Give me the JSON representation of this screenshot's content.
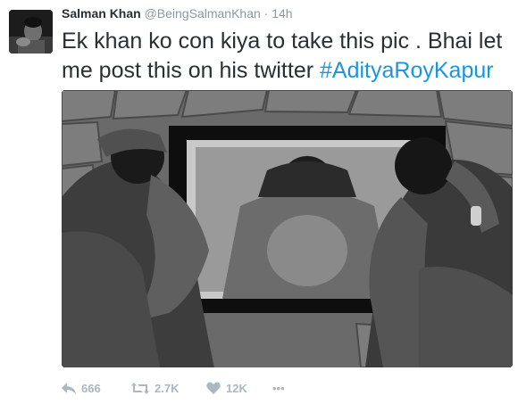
{
  "tweet": {
    "author_name": "Salman Khan",
    "handle": "@BeingSalmanKhan",
    "separator": "·",
    "time": "14h",
    "text_main": "Ek khan ko con kiya to take this pic . Bhai let me post this on his twitter ",
    "hashtag": "#AdityaRoyKapur"
  },
  "actions": {
    "reply_count": "666",
    "retweet_count": "2.7K",
    "like_count": "12K",
    "more_label": "•••"
  },
  "icons": {
    "reply": "reply-icon",
    "retweet": "retweet-icon",
    "like": "heart-icon",
    "more": "more-icon"
  },
  "colors": {
    "hashtag": "#1b95e0",
    "meta": "#8899a6",
    "action": "#aab8c2"
  }
}
